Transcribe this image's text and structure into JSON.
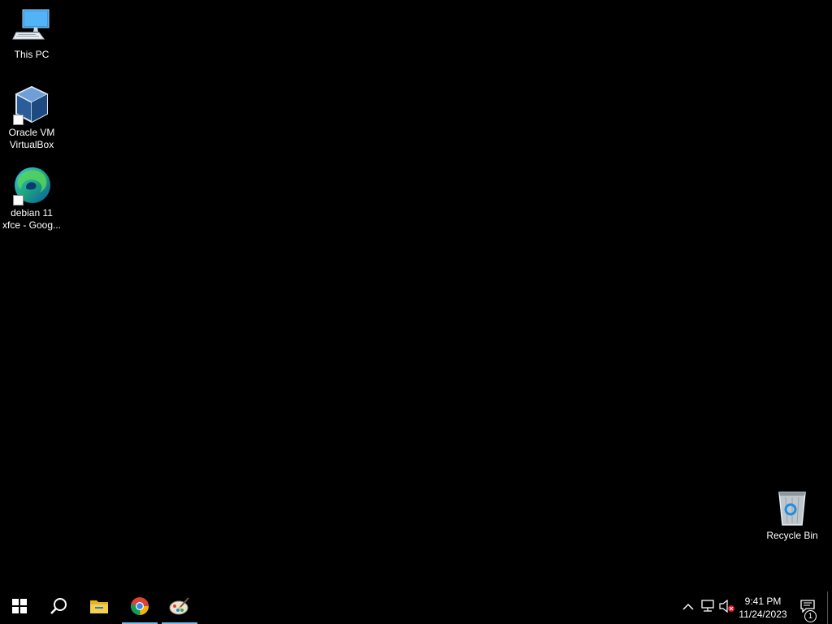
{
  "desktop": {
    "icons": [
      {
        "label": "This PC",
        "icon": "this-pc-icon"
      },
      {
        "label": "Oracle VM\nVirtualBox",
        "icon": "virtualbox-icon"
      },
      {
        "label": "debian 11\nxfce - Goog...",
        "icon": "edge-icon"
      },
      {
        "label": "Recycle Bin",
        "icon": "recycle-bin-icon"
      }
    ]
  },
  "taskbar": {
    "buttons": [
      {
        "name": "Start",
        "icon": "windows-start-icon"
      },
      {
        "name": "Search",
        "icon": "search-icon"
      },
      {
        "name": "File Explorer",
        "icon": "file-explorer-icon"
      },
      {
        "name": "Google Chrome",
        "icon": "chrome-icon"
      },
      {
        "name": "Paint",
        "icon": "paint-icon"
      }
    ],
    "tray": {
      "icons": [
        "chevron-up-icon",
        "network-icon",
        "volume-muted-icon"
      ],
      "time": "9:41 PM",
      "date": "11/24/2023",
      "notification_count": "1"
    }
  },
  "colors": {
    "background": "#000000",
    "active_indicator": "#76b9ed"
  }
}
